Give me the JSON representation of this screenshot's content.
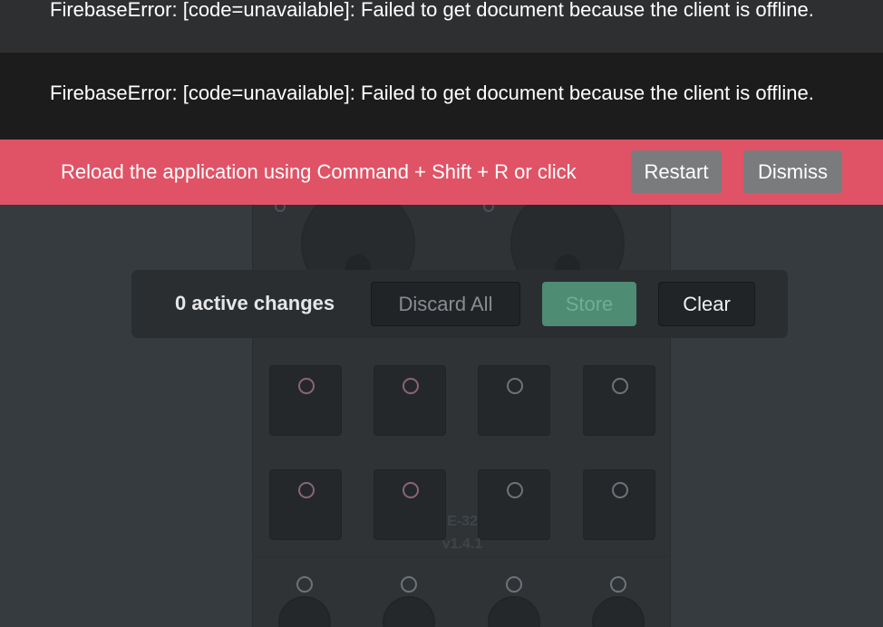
{
  "errors": [
    {
      "message": "FirebaseError: [code=unavailable]: Failed to get document because the client is offline."
    },
    {
      "message": "FirebaseError: [code=unavailable]: Failed to get document because the client is offline."
    }
  ],
  "reload_bar": {
    "text": "Reload the application using Command + Shift + R or click",
    "restart_label": "Restart",
    "dismiss_label": "Dismiss"
  },
  "changes_bar": {
    "count_text": "0 active changes",
    "discard_label": "Discard All",
    "store_label": "Store",
    "clear_label": "Clear"
  },
  "device": {
    "model": "E-32",
    "version": "v1.4.1"
  },
  "colors": {
    "reload_bar": "#e05366",
    "store_button": "#4e8c74",
    "background": "#363b3f"
  }
}
